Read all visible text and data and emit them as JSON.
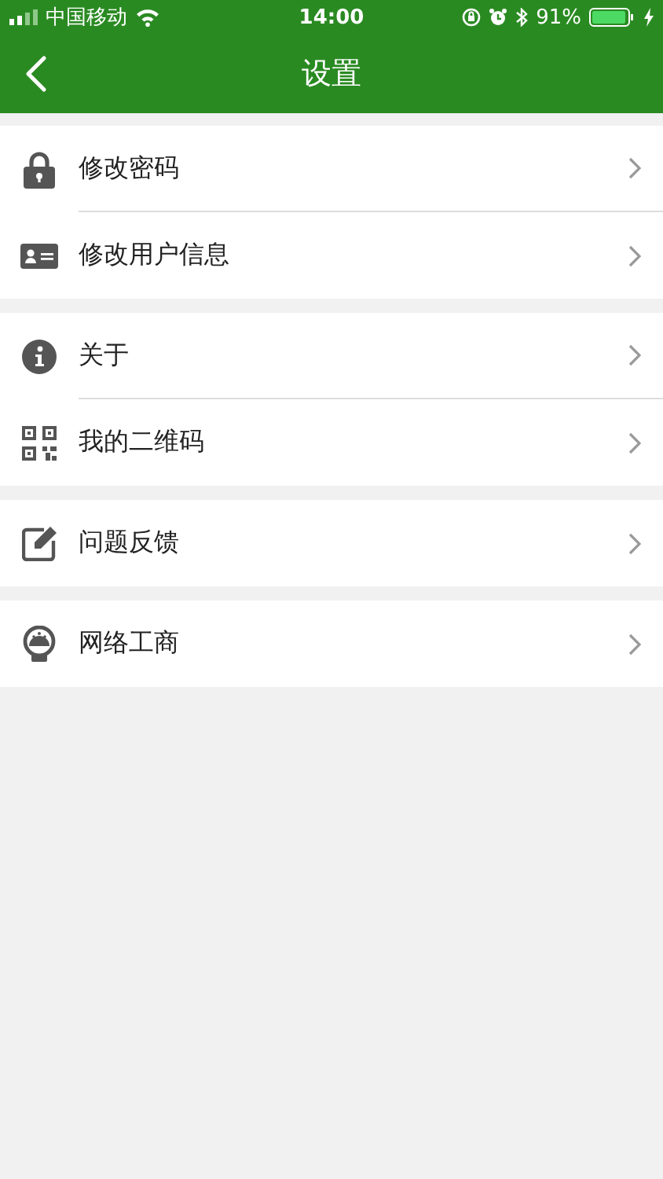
{
  "status_bar": {
    "carrier": "中国移动",
    "time": "14:00",
    "battery": "91%"
  },
  "nav": {
    "title": "设置"
  },
  "groups": [
    {
      "items": [
        {
          "kind": "lock",
          "label": "修改密码"
        },
        {
          "kind": "card",
          "label": "修改用户信息"
        }
      ]
    },
    {
      "items": [
        {
          "kind": "info",
          "label": "关于"
        },
        {
          "kind": "qr",
          "label": "我的二维码"
        }
      ]
    },
    {
      "items": [
        {
          "kind": "edit",
          "label": "问题反馈"
        }
      ]
    },
    {
      "items": [
        {
          "kind": "badge",
          "label": "网络工商"
        }
      ]
    }
  ]
}
